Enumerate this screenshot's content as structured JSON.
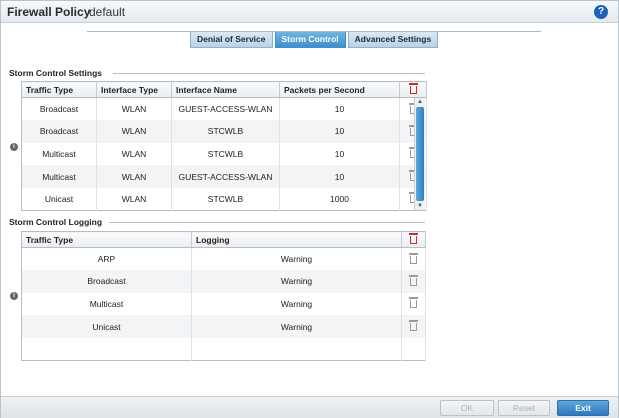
{
  "header": {
    "title": "Firewall Policy",
    "subtitle": "default",
    "help": "?"
  },
  "tabs": [
    {
      "label": "Denial of Service",
      "active": false
    },
    {
      "label": "Storm Control",
      "active": true
    },
    {
      "label": "Advanced Settings",
      "active": false
    }
  ],
  "storm_settings": {
    "title": "Storm Control Settings",
    "columns": [
      "Traffic Type",
      "Interface Type",
      "Interface Name",
      "Packets per Second"
    ],
    "rows": [
      [
        "Broadcast",
        "WLAN",
        "GUEST-ACCESS-WLAN",
        "10"
      ],
      [
        "Broadcast",
        "WLAN",
        "STCWLB",
        "10"
      ],
      [
        "Multicast",
        "WLAN",
        "STCWLB",
        "10"
      ],
      [
        "Multicast",
        "WLAN",
        "GUEST-ACCESS-WLAN",
        "10"
      ],
      [
        "Unicast",
        "WLAN",
        "STCWLB",
        "1000"
      ]
    ]
  },
  "storm_logging": {
    "title": "Storm Control Logging",
    "columns": [
      "Traffic Type",
      "Logging"
    ],
    "rows": [
      [
        "ARP",
        "Warning"
      ],
      [
        "Broadcast",
        "Warning"
      ],
      [
        "Multicast",
        "Warning"
      ],
      [
        "Unicast",
        "Warning"
      ]
    ]
  },
  "footer": {
    "ok": "OK",
    "reset": "Reset",
    "exit": "Exit"
  },
  "colors": {
    "accent": "#2b78bd",
    "delete_header": "#c0322b"
  }
}
